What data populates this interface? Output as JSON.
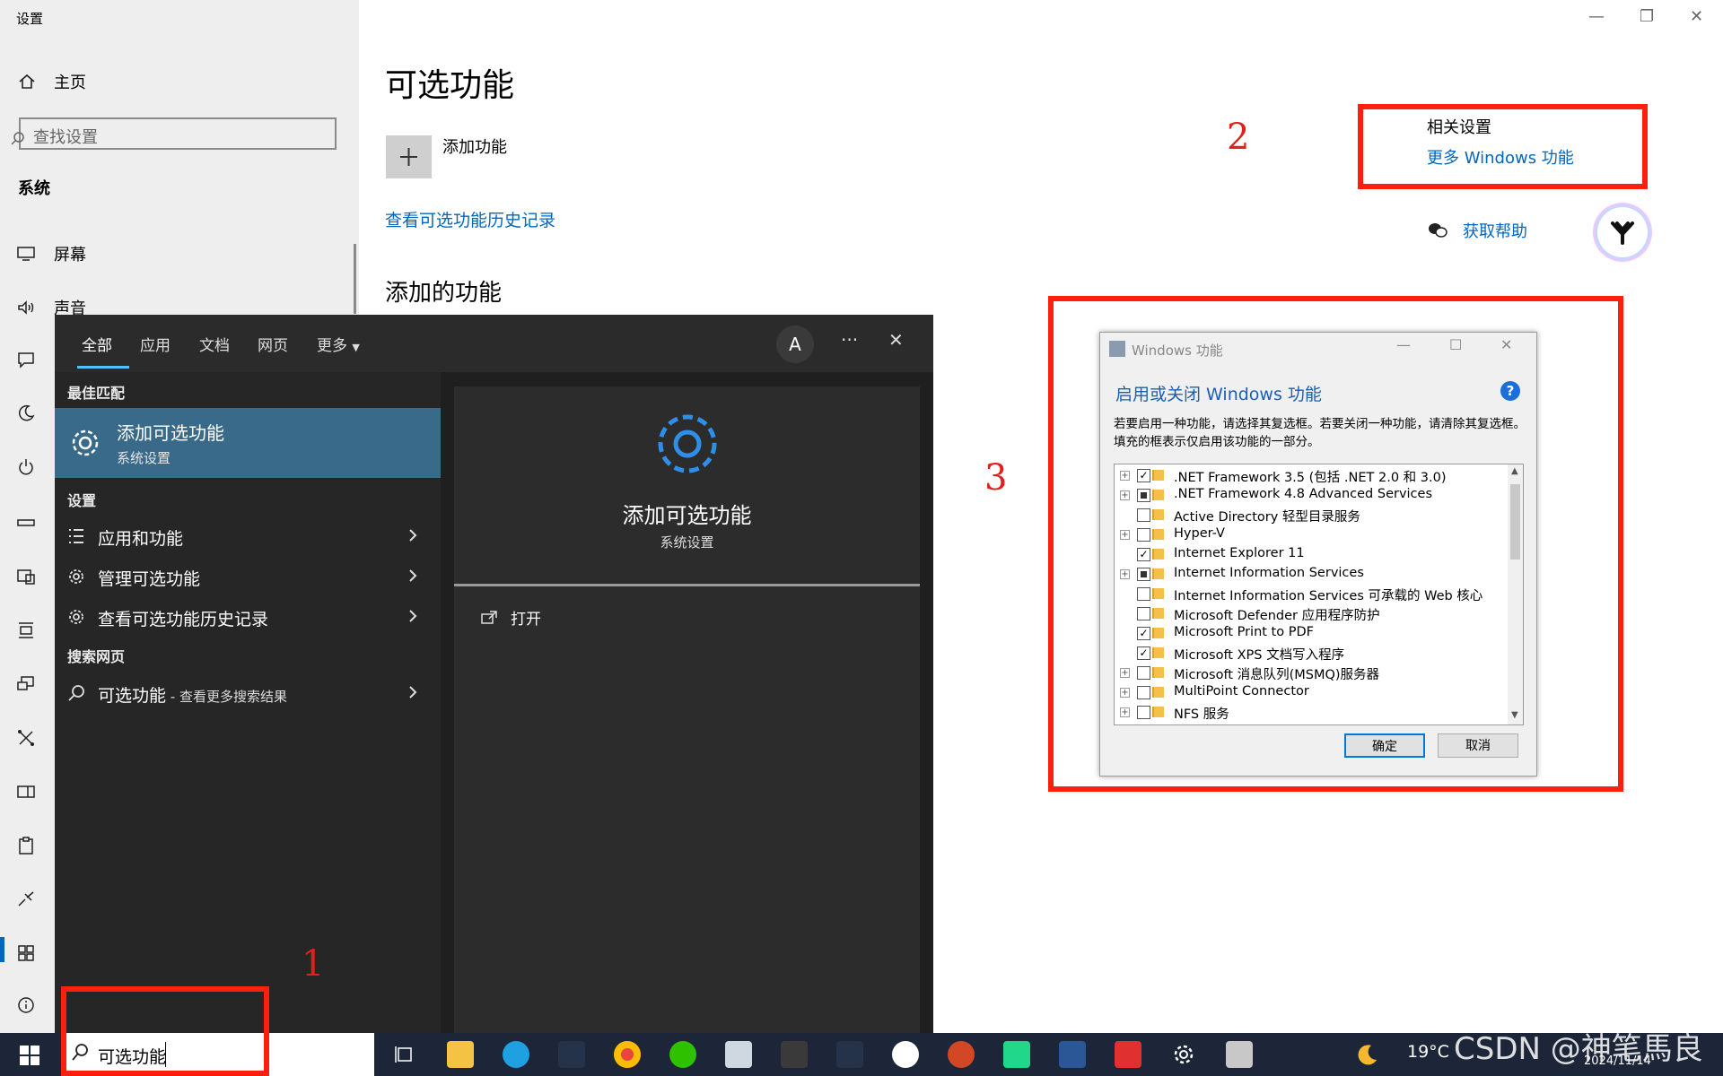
{
  "window": {
    "title": "设置"
  },
  "sidebar": {
    "home_label": "主页",
    "search_placeholder": "查找设置",
    "section_label": "系统",
    "items": [
      {
        "label": "屏幕",
        "icon": "display-icon"
      },
      {
        "label": "声音",
        "icon": "sound-icon"
      }
    ],
    "icons": [
      "notification-icon",
      "focus-assist-icon",
      "power-icon",
      "storage-icon",
      "tablet-icon",
      "multitask-icon",
      "projecting-icon",
      "shared-experiences-icon",
      "taskbar-panel-icon",
      "clipboard-icon",
      "remote-desktop-icon",
      "optional-features-icon",
      "about-icon"
    ]
  },
  "main": {
    "title": "可选功能",
    "add_feature_label": "添加功能",
    "history_link": "查看可选功能历史记录",
    "added_features_title": "添加的功能"
  },
  "related": {
    "title": "相关设置",
    "more_windows_features": "更多 Windows 功能",
    "get_help": "获取帮助"
  },
  "annotations": {
    "n1": "1",
    "n2": "2",
    "n3": "3"
  },
  "search_panel": {
    "tabs": [
      "全部",
      "应用",
      "文档",
      "网页",
      "更多"
    ],
    "avatar_letter": "A",
    "best_match_label": "最佳匹配",
    "best_match": {
      "title": "添加可选功能",
      "subtitle": "系统设置"
    },
    "settings_label": "设置",
    "settings_items": [
      "应用和功能",
      "管理可选功能",
      "查看可选功能历史记录"
    ],
    "web_label": "搜索网页",
    "web_item": {
      "query": "可选功能",
      "suffix": " - 查看更多搜索结果"
    },
    "preview": {
      "title": "添加可选功能",
      "subtitle": "系统设置",
      "open_label": "打开"
    }
  },
  "features_dialog": {
    "title": "Windows 功能",
    "heading": "启用或关闭 Windows 功能",
    "description": "若要启用一种功能，请选择其复选框。若要关闭一种功能，请清除其复选框。填充的框表示仅启用该功能的一部分。",
    "items": [
      {
        "label": ".NET Framework 3.5 (包括 .NET 2.0 和 3.0)",
        "state": "checked",
        "expandable": true
      },
      {
        "label": ".NET Framework 4.8 Advanced Services",
        "state": "partial",
        "expandable": true
      },
      {
        "label": "Active Directory 轻型目录服务",
        "state": "unchecked",
        "expandable": false
      },
      {
        "label": "Hyper-V",
        "state": "unchecked",
        "expandable": true
      },
      {
        "label": "Internet Explorer 11",
        "state": "checked",
        "expandable": false
      },
      {
        "label": "Internet Information Services",
        "state": "partial",
        "expandable": true
      },
      {
        "label": "Internet Information Services 可承载的 Web 核心",
        "state": "unchecked",
        "expandable": false
      },
      {
        "label": "Microsoft Defender 应用程序防护",
        "state": "unchecked",
        "expandable": false
      },
      {
        "label": "Microsoft Print to PDF",
        "state": "checked",
        "expandable": false
      },
      {
        "label": "Microsoft XPS 文档写入程序",
        "state": "checked",
        "expandable": false
      },
      {
        "label": "Microsoft 消息队列(MSMQ)服务器",
        "state": "unchecked",
        "expandable": true
      },
      {
        "label": "MultiPoint Connector",
        "state": "unchecked",
        "expandable": true
      },
      {
        "label": "NFS 服务",
        "state": "unchecked",
        "expandable": true
      }
    ],
    "ok_label": "确定",
    "cancel_label": "取消"
  },
  "taskbar": {
    "search_text": "可选功能",
    "weather": "19°C",
    "date": "2024/11/14",
    "watermark": "CSDN @神笔馬良"
  }
}
